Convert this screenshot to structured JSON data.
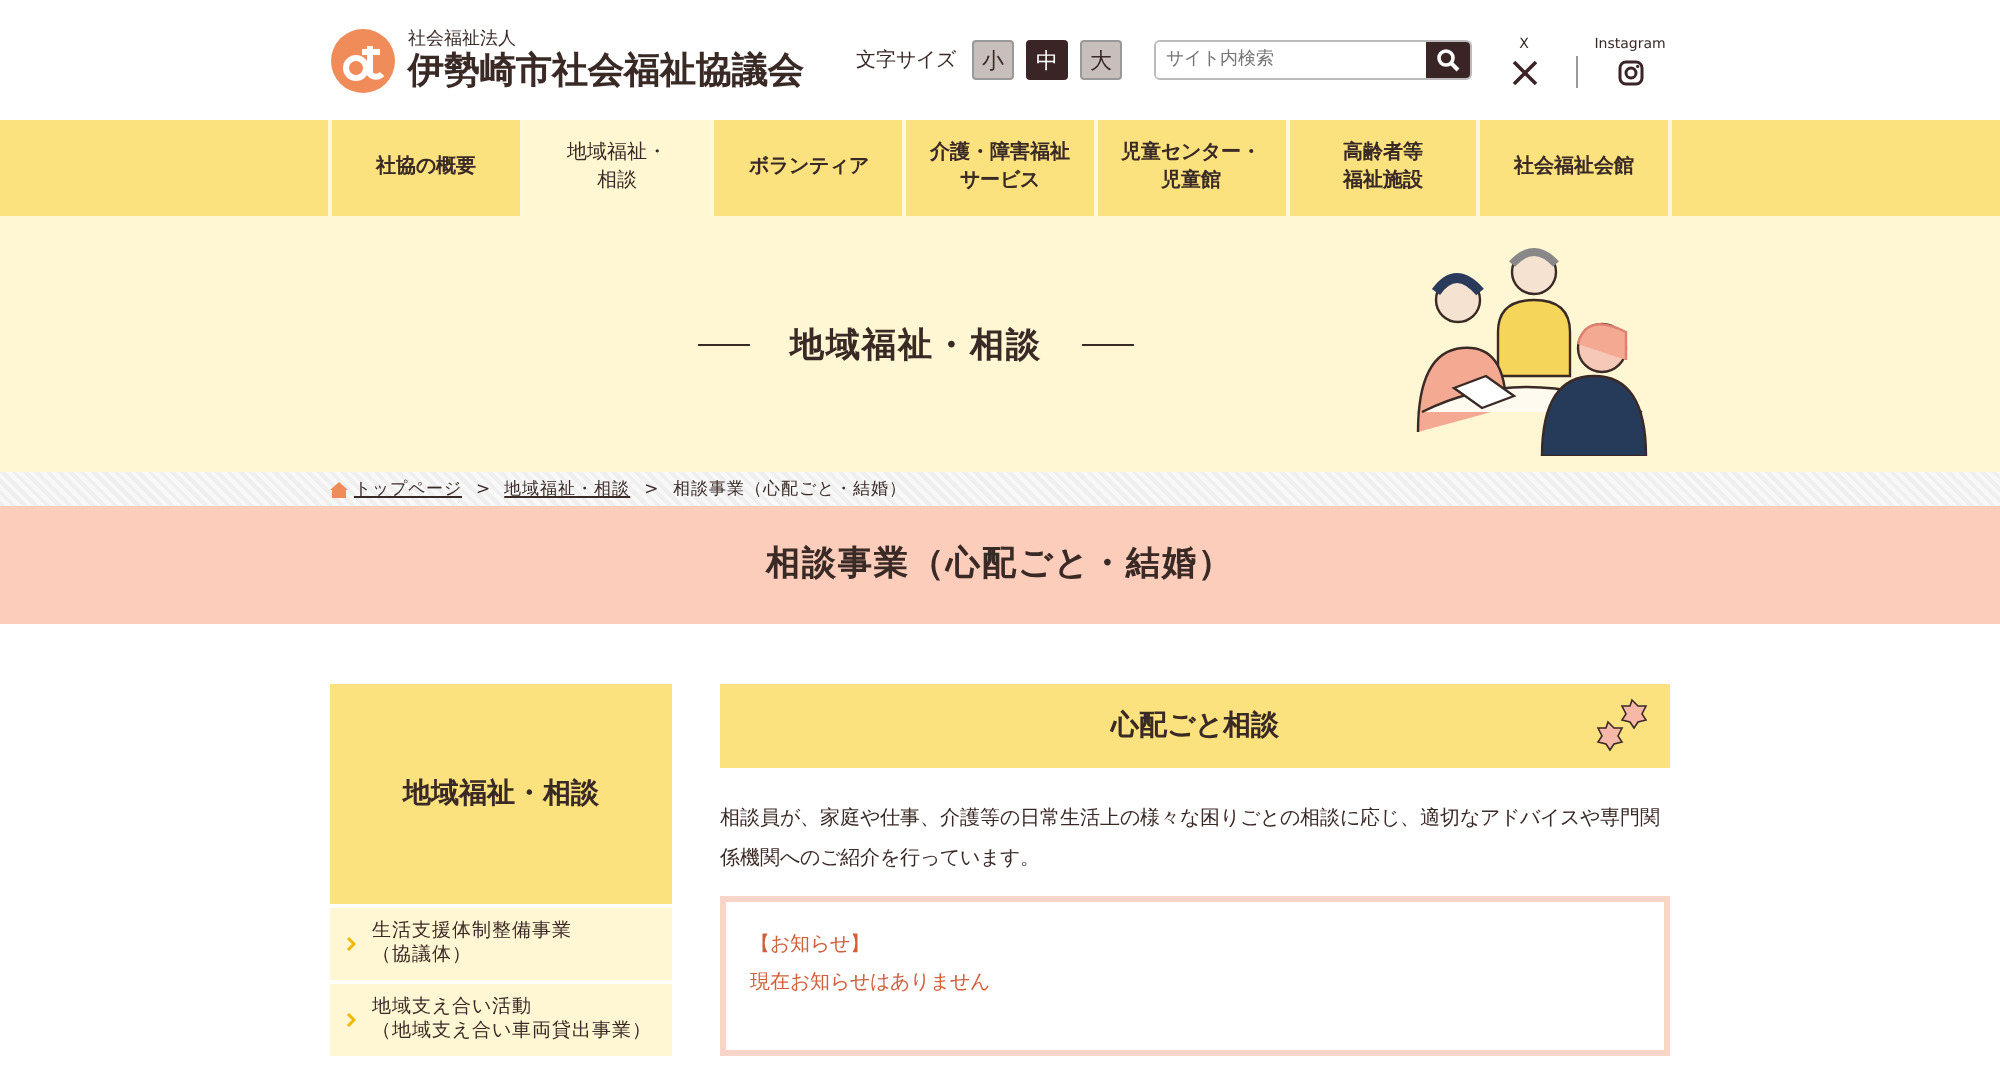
{
  "header": {
    "org_type": "社会福祉法人",
    "org_name": "伊勢崎市社会福祉協議会",
    "font_size_label": "文字サイズ",
    "font_sizes": [
      {
        "label": "小",
        "selected": false
      },
      {
        "label": "中",
        "selected": true
      },
      {
        "label": "大",
        "selected": false
      }
    ],
    "search": {
      "placeholder": "サイト内検索"
    },
    "social": [
      {
        "kind": "x",
        "label": "X"
      },
      {
        "kind": "instagram",
        "label": "Instagram"
      }
    ]
  },
  "nav": [
    {
      "lines": [
        "社協の概要"
      ],
      "selected": false
    },
    {
      "lines": [
        "地域福祉・",
        "相談"
      ],
      "selected": true
    },
    {
      "lines": [
        "ボランティア"
      ],
      "selected": false
    },
    {
      "lines": [
        "介護・障害福祉",
        "サービス"
      ],
      "selected": false
    },
    {
      "lines": [
        "児童センター・",
        "児童館"
      ],
      "selected": false
    },
    {
      "lines": [
        "高齢者等",
        "福祉施設"
      ],
      "selected": false
    },
    {
      "lines": [
        "社会福祉会館"
      ],
      "selected": false
    }
  ],
  "hero": {
    "title": "地域福祉・相談"
  },
  "breadcrumb": [
    {
      "kind": "home",
      "label": "トップページ"
    },
    {
      "kind": "separator",
      "label": ">"
    },
    {
      "kind": "link",
      "label": "地域福祉・相談"
    },
    {
      "kind": "separator",
      "label": ">"
    },
    {
      "kind": "current",
      "label": "相談事業（心配ごと・結婚）"
    }
  ],
  "page_title": "相談事業（心配ごと・結婚）",
  "sidebar": {
    "title": "地域福祉・相談",
    "items": [
      {
        "lines": [
          "生活支援体制整備事業",
          "（協議体）"
        ]
      },
      {
        "lines": [
          "地域支え合い活動",
          "（地域支え合い車両貸出事業）"
        ]
      }
    ]
  },
  "main": {
    "heading": "心配ごと相談",
    "body": "相談員が、家庭や仕事、介護等の日常生活上の様々な困りごとの相談に応じ、適切なアドバイスや専門関係機関へのご紹介を行っています。",
    "notice": {
      "title": "【お知らせ】",
      "text": "現在お知らせはありません"
    }
  }
}
